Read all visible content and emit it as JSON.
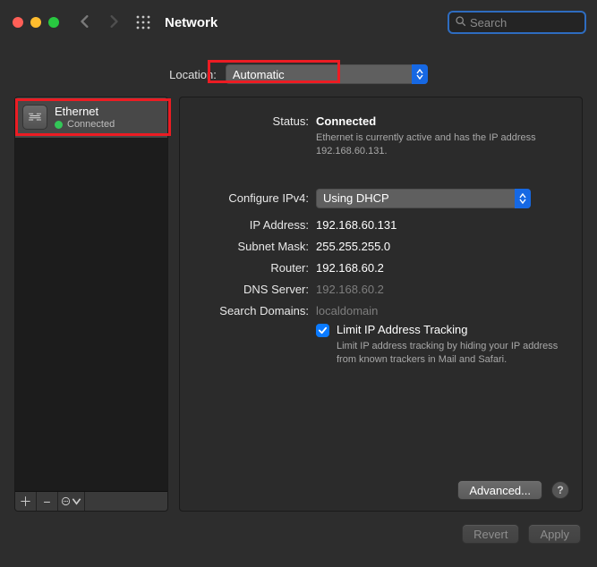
{
  "title": "Network",
  "search_placeholder": "Search",
  "location": {
    "label": "Location:",
    "value": "Automatic"
  },
  "sidebar": {
    "services": [
      {
        "name": "Ethernet",
        "status_text": "Connected",
        "status_color": "#33c758"
      }
    ],
    "add": "+",
    "remove": "−"
  },
  "detail": {
    "status_label": "Status:",
    "status_value": "Connected",
    "status_note": "Ethernet is currently active and has the IP address 192.168.60.131.",
    "configure_label": "Configure IPv4:",
    "configure_value": "Using DHCP",
    "ip_label": "IP Address:",
    "ip_value": "192.168.60.131",
    "mask_label": "Subnet Mask:",
    "mask_value": "255.255.255.0",
    "router_label": "Router:",
    "router_value": "192.168.60.2",
    "dns_label": "DNS Server:",
    "dns_value": "192.168.60.2",
    "domains_label": "Search Domains:",
    "domains_value": "localdomain",
    "limit_label": "Limit IP Address Tracking",
    "limit_note": "Limit IP address tracking by hiding your IP address from known trackers in Mail and Safari.",
    "advanced": "Advanced...",
    "help": "?"
  },
  "footer": {
    "revert": "Revert",
    "apply": "Apply"
  }
}
